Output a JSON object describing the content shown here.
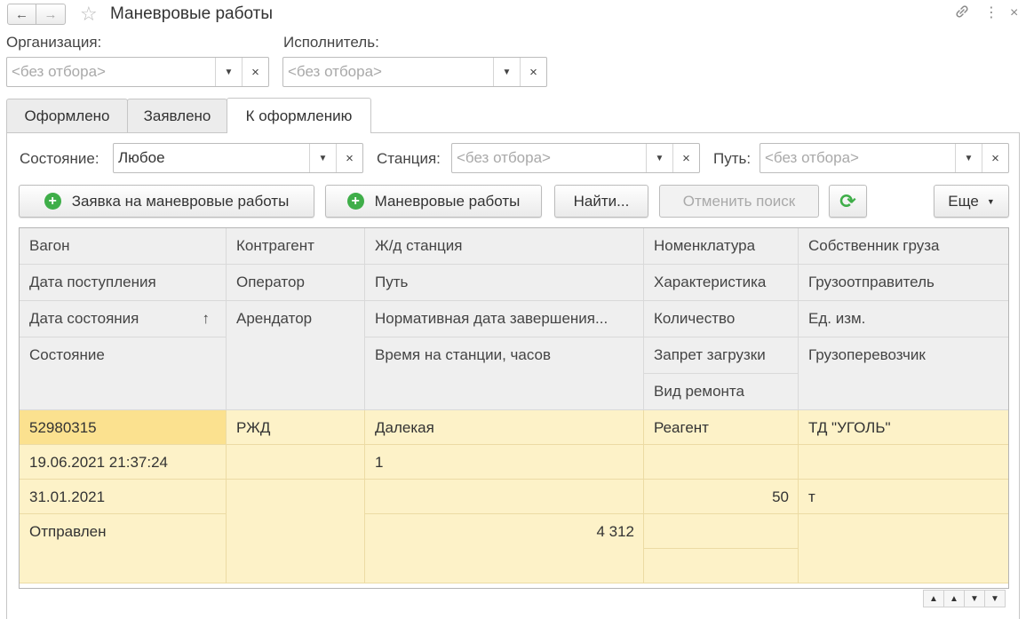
{
  "window": {
    "title": "Маневровые работы",
    "back_icon": "←",
    "forward_icon": "→",
    "favorite_icon": "☆",
    "link_icon": "🔗",
    "more_icon": "⋮",
    "close_icon": "×"
  },
  "filters_top": {
    "organization_label": "Организация:",
    "organization_placeholder": "<без отбора>",
    "executor_label": "Исполнитель:",
    "executor_placeholder": "<без отбора>"
  },
  "tabs": [
    {
      "label": "Оформлено"
    },
    {
      "label": "Заявлено"
    },
    {
      "label": "К оформлению"
    }
  ],
  "filters": {
    "state_label": "Состояние:",
    "state_value": "Любое",
    "station_label": "Станция:",
    "station_placeholder": "<без отбора>",
    "track_label": "Путь:",
    "track_placeholder": "<без отбора>"
  },
  "toolbar": {
    "request_button": "Заявка на маневровые работы",
    "shunting_button": "Маневровые работы",
    "find_button": "Найти...",
    "cancel_search_button": "Отменить поиск",
    "more_button": "Еще",
    "refresh_icon": "⟳"
  },
  "table": {
    "headers": {
      "col1": [
        "Вагон",
        "Дата поступления",
        "Дата состояния",
        "Состояние"
      ],
      "col2": [
        "Контрагент",
        "Оператор",
        "Арендатор"
      ],
      "col3": [
        "Ж/д станция",
        "Путь",
        "Нормативная дата завершения...",
        "Время на станции, часов"
      ],
      "col4": [
        "Номенклатура",
        "Характеристика",
        "Количество",
        "Запрет загрузки",
        "Вид ремонта"
      ],
      "col5": [
        "Собственник груза",
        "Грузоотправитель",
        "Ед. изм.",
        "Грузоперевозчик"
      ]
    },
    "sort_icon": "↑",
    "row": {
      "wagon": "52980315",
      "arrival_date": "19.06.2021 21:37:24",
      "state_date": "31.01.2021",
      "state": "Отправлен",
      "counterparty": "РЖД",
      "station": "Далекая",
      "track": "1",
      "hours_on_station": "4 312",
      "nomenclature": "Реагент",
      "quantity": "50",
      "cargo_owner": "ТД \"УГОЛЬ\"",
      "unit": "т"
    }
  },
  "colors": {
    "accent_green": "#3fae49",
    "row_bg": "#fdf2c8",
    "row_selected": "#fbe18f",
    "header_bg": "#efefef"
  }
}
